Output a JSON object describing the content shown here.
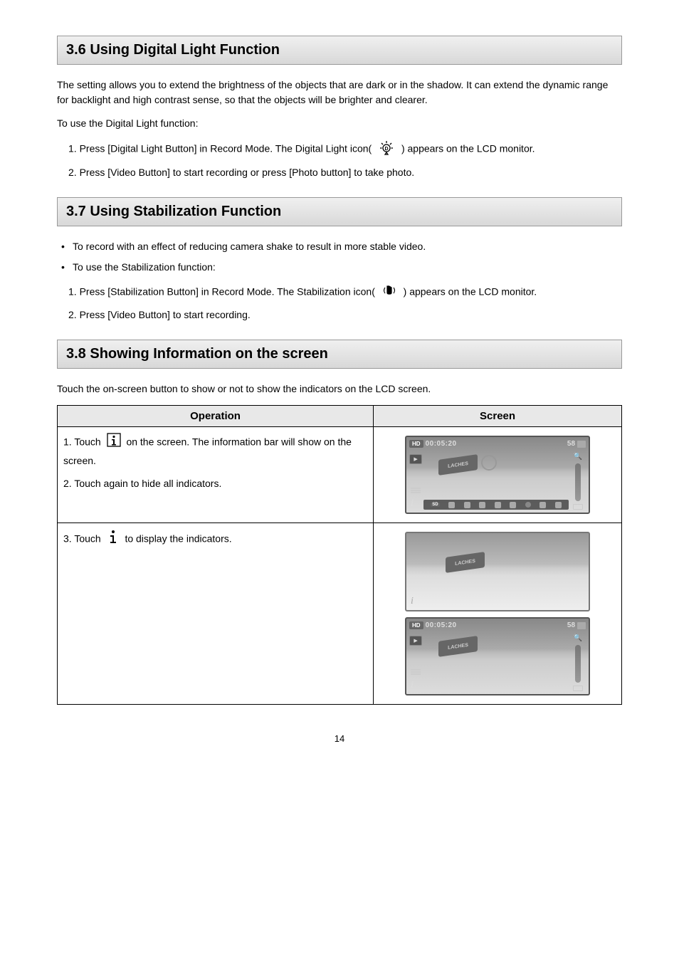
{
  "sections": {
    "s36": {
      "title": "3.6 Using Digital Light Function",
      "intro": "The setting allows you to extend the brightness of the objects that are dark or in the shadow. It can extend the dynamic range for backlight and high contrast sense, so that the objects will be brighter and clearer.",
      "lead": "To use the Digital Light function:",
      "step1_a": "1. Press [Digital Light Button] in Record Mode. The Digital Light icon(",
      "step1_b": ") appears on the LCD monitor.",
      "step2": "2. Press [Video Button] to start recording or press [Photo button] to take photo."
    },
    "s37": {
      "title": "3.7 Using Stabilization Function",
      "bullet1": "To record with an effect of reducing camera shake to result in more stable video.",
      "bullet2": "To use the Stabilization function:",
      "step1_a": "1. Press [Stabilization Button] in Record Mode. The Stabilization icon(",
      "step1_b": ") appears on the LCD monitor.",
      "step2": "2. Press [Video Button] to start recording."
    },
    "s38": {
      "title": "3.8 Showing Information on the screen",
      "intro": "Touch the on-screen button to show or not to show the indicators on the LCD screen.",
      "table": {
        "header_operation": "Operation",
        "header_screen": "Screen",
        "row1_step1_a": "1. Touch",
        "row1_step1_b": "on the screen. The information bar will show on the screen.",
        "row1_step2": "2. Touch again to hide all indicators.",
        "row2_step3_a": "3. Touch",
        "row2_step3_b": "to display the indicators."
      }
    }
  },
  "screenshots": {
    "hd_badge": "HD",
    "sd_badge": "SD",
    "time": "00:05:20",
    "count": "58",
    "sign": "LACHES",
    "info_glyph": "i"
  },
  "page_number": "14"
}
